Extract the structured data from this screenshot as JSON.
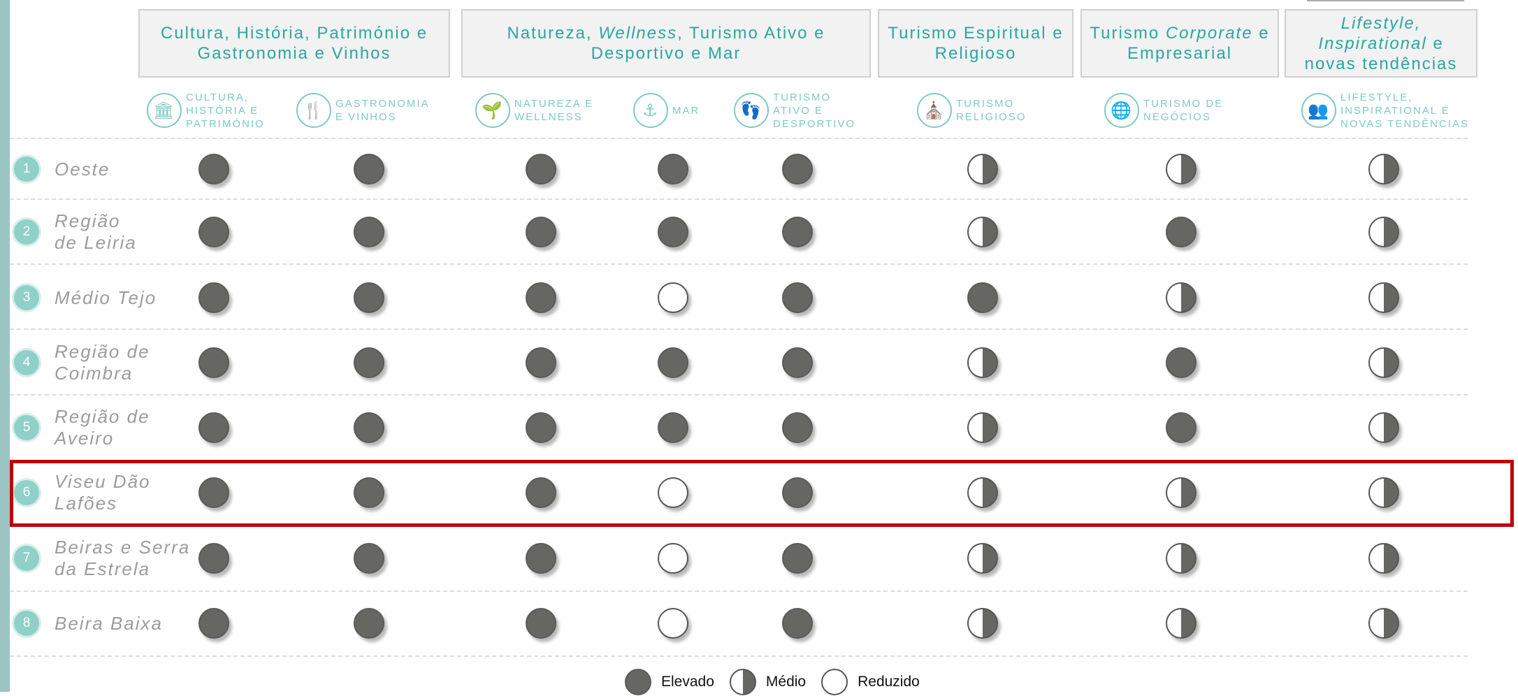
{
  "group_headers": [
    {
      "parts": [
        [
          "Cultura, Hist",
          false
        ],
        [
          "ó",
          false
        ],
        [
          "ria, Patrim",
          false
        ],
        [
          "ó",
          false
        ],
        [
          "nio e Gastronomia e Vinhos",
          false
        ]
      ]
    },
    {
      "parts": [
        [
          "Natureza, ",
          false
        ],
        [
          "Wellness",
          true
        ],
        [
          ", Turismo Ativo e Desportivo e Mar",
          false
        ]
      ]
    },
    {
      "parts": [
        [
          "Turismo Espiritual e Religioso",
          false
        ]
      ]
    },
    {
      "parts": [
        [
          "Turismo ",
          false
        ],
        [
          "Corporate",
          true
        ],
        [
          " e Empresarial",
          false
        ]
      ]
    },
    {
      "parts": [
        [
          "Lifestyle, Inspirational",
          true
        ],
        [
          " e novas tend",
          false
        ],
        [
          "ê",
          false
        ],
        [
          "ncias",
          false
        ]
      ]
    }
  ],
  "subcategories": [
    {
      "icon": "museum-icon",
      "glyph": "🏛",
      "label": "Cultura,\nhistória e\npatrimónio",
      "italic": false
    },
    {
      "icon": "cutlery-icon",
      "glyph": "🍴",
      "label": "Gastronomia\ne vinhos",
      "italic": false
    },
    {
      "icon": "sprout-icon",
      "glyph": "🌱",
      "label": "Natureza e\nwellness",
      "italic": false
    },
    {
      "icon": "anchor-icon",
      "glyph": "⚓",
      "label": "Mar",
      "italic": false
    },
    {
      "icon": "footprints-icon",
      "glyph": "👣",
      "label": "Turismo\nativo e\ndesportivo",
      "italic": false
    },
    {
      "icon": "church-icon",
      "glyph": "⛪",
      "label": "Turismo\nreligioso",
      "italic": false
    },
    {
      "icon": "globe-icon",
      "glyph": "🌐",
      "label": "Turismo de\nnegócios",
      "italic": false
    },
    {
      "icon": "people-icon",
      "glyph": "👥",
      "label": "Lifestyle,\ninspirational e\nnovas tendências",
      "italic": false
    }
  ],
  "regions": [
    {
      "number": "1",
      "name": "Oeste",
      "ratings": [
        "elevado",
        "elevado",
        "elevado",
        "elevado",
        "elevado",
        "medio",
        "medio",
        "medio"
      ]
    },
    {
      "number": "2",
      "name": "Região\nde Leiria",
      "ratings": [
        "elevado",
        "elevado",
        "elevado",
        "elevado",
        "elevado",
        "medio",
        "elevado",
        "medio"
      ]
    },
    {
      "number": "3",
      "name": "Médio Tejo",
      "ratings": [
        "elevado",
        "elevado",
        "elevado",
        "reduzido",
        "elevado",
        "elevado",
        "medio",
        "medio"
      ]
    },
    {
      "number": "4",
      "name": "Região de\nCoimbra",
      "ratings": [
        "elevado",
        "elevado",
        "elevado",
        "elevado",
        "elevado",
        "medio",
        "elevado",
        "medio"
      ]
    },
    {
      "number": "5",
      "name": "Região de\nAveiro",
      "ratings": [
        "elevado",
        "elevado",
        "elevado",
        "elevado",
        "elevado",
        "medio",
        "elevado",
        "medio"
      ]
    },
    {
      "number": "6",
      "name": "Viseu Dão\nLafões",
      "ratings": [
        "elevado",
        "elevado",
        "elevado",
        "reduzido",
        "elevado",
        "medio",
        "medio",
        "medio"
      ]
    },
    {
      "number": "7",
      "name": "Beiras e Serra\nda Estrela",
      "ratings": [
        "elevado",
        "elevado",
        "elevado",
        "reduzido",
        "elevado",
        "medio",
        "medio",
        "medio"
      ]
    },
    {
      "number": "8",
      "name": "Beira Baixa",
      "ratings": [
        "elevado",
        "elevado",
        "elevado",
        "reduzido",
        "elevado",
        "medio",
        "medio",
        "medio"
      ]
    }
  ],
  "highlighted_region": "6",
  "legend": [
    {
      "key": "elevado",
      "label": "Elevado"
    },
    {
      "key": "medio",
      "label": "Médio"
    },
    {
      "key": "reduzido",
      "label": "Reduzido"
    }
  ],
  "colors": {
    "accent": "#2aa7a0",
    "accent_light": "#7fcac4",
    "dot_fill": "#666663",
    "highlight": "#c0000c",
    "left_bar": "#9cc4c2"
  }
}
